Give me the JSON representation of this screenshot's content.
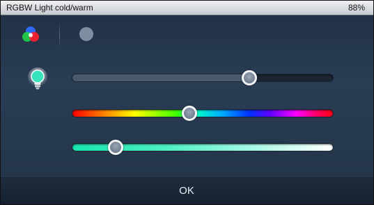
{
  "window": {
    "title": "RGBW Light cold/warm",
    "percent": "88%"
  },
  "modes": {
    "color_icon": "rgb-circles-icon",
    "white_icon": "white-dot-icon"
  },
  "sliders": {
    "brightness": {
      "icon": "light-bulb-icon",
      "value": 0.68
    },
    "hue": {
      "value": 0.45
    },
    "temperature": {
      "value": 0.165,
      "start_color": "#18e6ae",
      "end_color": "#ffffff"
    }
  },
  "footer": {
    "ok_label": "OK"
  }
}
